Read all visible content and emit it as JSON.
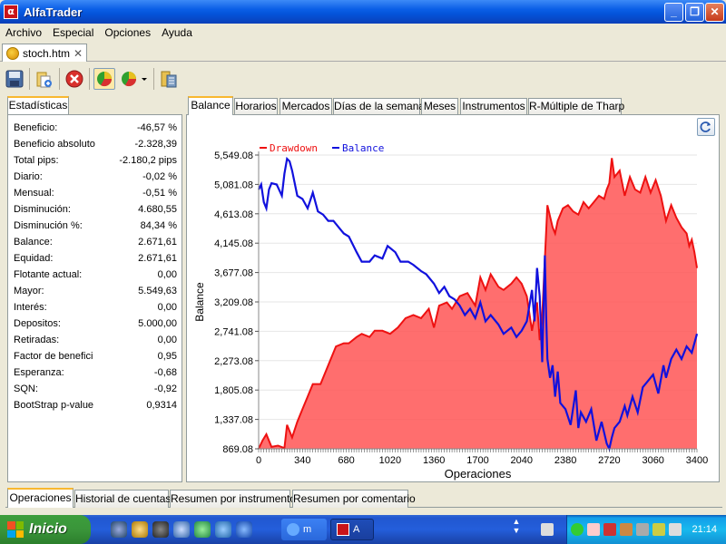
{
  "window": {
    "title": "AlfaTrader",
    "logo_text": "α"
  },
  "menu": [
    "Archivo",
    "Especial",
    "Opciones",
    "Ayuda"
  ],
  "doc_tab": {
    "label": "stoch.htm"
  },
  "toolbar": {
    "icons": [
      "save-icon",
      "open-folder-icon",
      "stop-icon",
      "pie-chart-icon",
      "pie-chart-dropdown-icon",
      "calculator-icon"
    ]
  },
  "stats": {
    "tab": "Estadísticas",
    "rows": [
      {
        "label": "Beneficio:",
        "value": "-46,57 %"
      },
      {
        "label": "Beneficio absoluto",
        "value": "-2.328,39"
      },
      {
        "label": "Total pips:",
        "value": "-2.180,2 pips"
      },
      {
        "label": "Diario:",
        "value": "-0,02 %"
      },
      {
        "label": "Mensual:",
        "value": "-0,51 %"
      },
      {
        "label": "Disminución:",
        "value": "4.680,55"
      },
      {
        "label": "Disminución %:",
        "value": "84,34 %"
      },
      {
        "label": "Balance:",
        "value": "2.671,61"
      },
      {
        "label": "Equidad:",
        "value": "2.671,61"
      },
      {
        "label": "Flotante actual:",
        "value": "0,00"
      },
      {
        "label": "Mayor:",
        "value": "5.549,63"
      },
      {
        "label": "Interés:",
        "value": "0,00"
      },
      {
        "label": "Depositos:",
        "value": "5.000,00"
      },
      {
        "label": "Retiradas:",
        "value": "0,00"
      },
      {
        "label": "Factor de benefici",
        "value": "0,95"
      },
      {
        "label": "Esperanza:",
        "value": "-0,68"
      },
      {
        "label": "SQN:",
        "value": "-0,92"
      },
      {
        "label": "BootStrap p-value",
        "value": "0,9314"
      }
    ]
  },
  "chart_tabs": [
    "Balance",
    "Horarios",
    "Mercados",
    "Días de la semana",
    "Meses",
    "Instrumentos",
    "R-Múltiple de Tharp"
  ],
  "bottom_tabs": [
    "Operaciones",
    "Historial de cuentas",
    "Resumen por instrumento",
    "Resumen por comentario"
  ],
  "taskbar": {
    "start": "Inicio",
    "tasks": [
      {
        "label": "m"
      },
      {
        "label": "A"
      }
    ],
    "clock": "21:14"
  },
  "chart_data": {
    "type": "area",
    "xlabel": "Operaciones",
    "ylabel": "Balance",
    "xlim": [
      0,
      3400
    ],
    "ylim": [
      869.08,
      5549.08
    ],
    "xticks": [
      "0",
      "340",
      "680",
      "1020",
      "1360",
      "1700",
      "2040",
      "2380",
      "2720",
      "3060",
      "3400"
    ],
    "yticks": [
      "5,549.08",
      "5,081.08",
      "4,613.08",
      "4,145.08",
      "3,677.08",
      "3,209.08",
      "2,741.08",
      "2,273.08",
      "1,805.08",
      "1,337.08",
      "869.08"
    ],
    "legend_position": "top-left",
    "series": [
      {
        "name": "Drawdown",
        "color": "#ee1111",
        "fill": "#ff5555",
        "x": [
          0,
          30,
          60,
          100,
          150,
          200,
          220,
          260,
          300,
          340,
          380,
          420,
          480,
          540,
          600,
          660,
          700,
          760,
          800,
          860,
          900,
          960,
          1020,
          1080,
          1140,
          1200,
          1260,
          1320,
          1360,
          1400,
          1460,
          1500,
          1560,
          1620,
          1680,
          1720,
          1760,
          1800,
          1860,
          1900,
          1960,
          2000,
          2040,
          2080,
          2120,
          2160,
          2180,
          2200,
          2240,
          2280,
          2300,
          2320,
          2360,
          2400,
          2440,
          2480,
          2520,
          2560,
          2600,
          2640,
          2680,
          2700,
          2720,
          2740,
          2760,
          2800,
          2840,
          2880,
          2920,
          2960,
          3000,
          3040,
          3080,
          3120,
          3160,
          3200,
          3240,
          3280,
          3320,
          3340,
          3360,
          3380,
          3400
        ],
        "y": [
          869,
          1000,
          1100,
          900,
          920,
          880,
          1250,
          1050,
          1300,
          1500,
          1700,
          1900,
          1900,
          2200,
          2500,
          2550,
          2550,
          2650,
          2700,
          2650,
          2750,
          2750,
          2700,
          2800,
          2950,
          3000,
          2950,
          3100,
          2800,
          3150,
          3200,
          3100,
          3300,
          3350,
          3150,
          3600,
          3400,
          3650,
          3450,
          3400,
          3500,
          3600,
          3500,
          3300,
          2750,
          3200,
          2600,
          3000,
          4750,
          4400,
          4300,
          4500,
          4700,
          4750,
          4650,
          4600,
          4800,
          4700,
          4800,
          4900,
          4850,
          5000,
          5100,
          5500,
          5200,
          5300,
          4900,
          5200,
          5000,
          4950,
          5200,
          4950,
          5150,
          4900,
          4500,
          4750,
          4550,
          4400,
          4300,
          4100,
          4200,
          4000,
          3750
        ]
      },
      {
        "name": "Balance",
        "color": "#1111dd",
        "x": [
          0,
          20,
          40,
          60,
          80,
          100,
          140,
          180,
          200,
          220,
          240,
          260,
          300,
          340,
          380,
          420,
          460,
          500,
          540,
          580,
          620,
          660,
          700,
          760,
          800,
          860,
          900,
          960,
          1000,
          1060,
          1100,
          1160,
          1200,
          1260,
          1300,
          1360,
          1400,
          1440,
          1480,
          1520,
          1560,
          1600,
          1640,
          1680,
          1720,
          1760,
          1800,
          1860,
          1900,
          1960,
          2000,
          2040,
          2080,
          2120,
          2140,
          2160,
          2180,
          2200,
          2220,
          2230,
          2240,
          2260,
          2280,
          2300,
          2320,
          2340,
          2380,
          2420,
          2460,
          2480,
          2500,
          2540,
          2580,
          2620,
          2660,
          2700,
          2720,
          2740,
          2760,
          2800,
          2840,
          2860,
          2900,
          2940,
          2980,
          3020,
          3060,
          3100,
          3140,
          3160,
          3200,
          3240,
          3280,
          3320,
          3360,
          3400
        ],
        "y": [
          5000,
          5080,
          4800,
          4700,
          5000,
          5100,
          5080,
          4900,
          5250,
          5490,
          5450,
          5300,
          4900,
          4850,
          4700,
          4950,
          4650,
          4600,
          4500,
          4500,
          4400,
          4300,
          4250,
          4000,
          3850,
          3850,
          3950,
          3900,
          4100,
          4000,
          3850,
          3850,
          3800,
          3700,
          3650,
          3500,
          3350,
          3450,
          3300,
          3250,
          3150,
          3000,
          3100,
          2950,
          3200,
          2900,
          3000,
          2850,
          2700,
          2800,
          2650,
          2750,
          2900,
          3400,
          2900,
          3750,
          3300,
          2250,
          3950,
          3000,
          2300,
          2000,
          2200,
          1700,
          2100,
          1600,
          1500,
          1250,
          1800,
          1200,
          1450,
          1300,
          1500,
          1000,
          1300,
          950,
          869,
          1050,
          1200,
          1300,
          1550,
          1400,
          1700,
          1450,
          1850,
          1950,
          2050,
          1750,
          2200,
          2000,
          2300,
          2450,
          2300,
          2500,
          2400,
          2700
        ]
      }
    ]
  }
}
